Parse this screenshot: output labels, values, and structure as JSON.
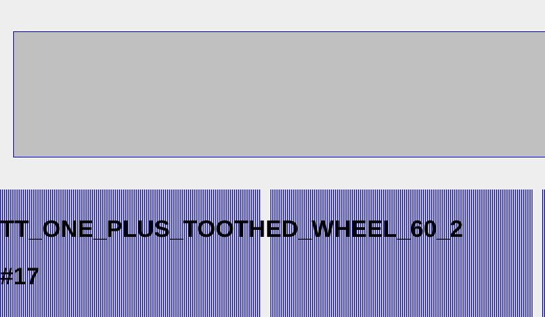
{
  "item": {
    "name": "TT_ONE_PLUS_TOOTHED_WHEEL_60_2",
    "index": "#17"
  },
  "colors": {
    "background": "#eeeeee",
    "panel": "#c0c0c0",
    "border": "#0000c8",
    "stripe": "#0000c0",
    "text": "#000000"
  }
}
